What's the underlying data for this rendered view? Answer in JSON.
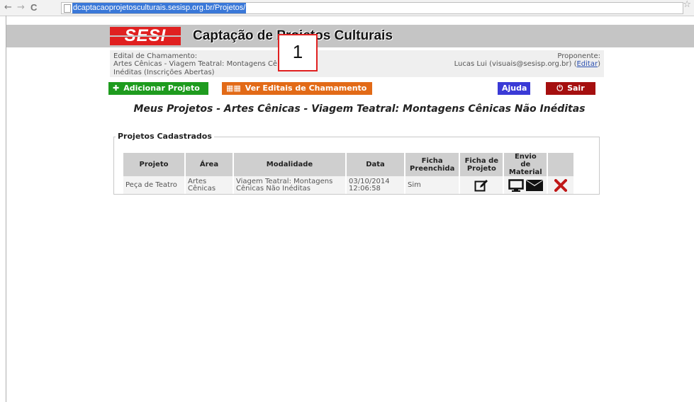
{
  "browser": {
    "back": "←",
    "forward": "→",
    "reload": "C",
    "url": "dcaptacaoprojetosculturais.sesisp.org.br/Projetos/",
    "star": "☆"
  },
  "header": {
    "logo": "SESI",
    "title": "Captação de Projetos Culturais"
  },
  "callout": "1",
  "info": {
    "edital_label": "Edital de Chamamento:",
    "edital_name": "Artes Cênicas - Viagem Teatral: Montagens Cênicas Não Inéditas (Inscrições Abertas)",
    "proponente_label": "Proponente:",
    "proponente_name": "Lucas Lui (visuais@sesisp.org.br)",
    "editar_link": "Editar"
  },
  "buttons": {
    "add": "Adicionar Projeto",
    "editais": "Ver Editais de Chamamento",
    "ajuda": "Ajuda",
    "sair": "Sair"
  },
  "colors": {
    "add": "#1e9b1e",
    "editais": "#e26a17",
    "ajuda": "#3a3ad6",
    "sair": "#a50f0f",
    "logo": "#e02020"
  },
  "heading": "Meus Projetos - Artes Cênicas - Viagem Teatral: Montagens Cênicas Não Inéditas",
  "fieldset_legend": "Projetos Cadastrados",
  "table": {
    "headers": [
      "Projeto",
      "Área",
      "Modalidade",
      "Data",
      "Ficha Preenchida",
      "Ficha de Projeto",
      "Envio de Material",
      ""
    ],
    "rows": [
      {
        "projeto": "Peça de Teatro",
        "area": "Artes Cênicas",
        "modalidade": "Viagem Teatral: Montagens Cênicas Não Inéditas",
        "data": "03/10/2014 12:06:58",
        "ficha_preenchida": "Sim",
        "ficha_icon": "edit-icon",
        "envio_icons": [
          "monitor-icon",
          "envelope-icon"
        ],
        "delete_icon": "delete-icon"
      }
    ]
  }
}
